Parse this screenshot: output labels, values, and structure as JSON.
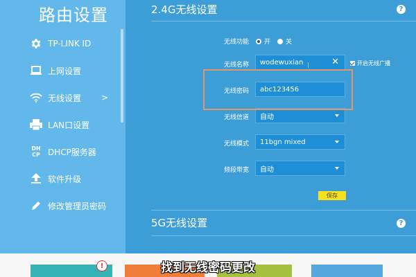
{
  "sidebar": {
    "title": "路由设置",
    "items": [
      {
        "label": "TP-LINK ID",
        "icon": "gear-icon"
      },
      {
        "label": "上网设置",
        "icon": "monitor-icon"
      },
      {
        "label": "无线设置",
        "icon": "wifi-icon",
        "chevron": ">"
      },
      {
        "label": "LAN口设置",
        "icon": "printer-icon"
      },
      {
        "label": "DHCP服务器",
        "icon": "dhcp-icon",
        "icon_text_top": "DH",
        "icon_text_bottom": "CP"
      },
      {
        "label": "软件升级",
        "icon": "upload-icon"
      },
      {
        "label": "修改管理员密码",
        "icon": "pencil-icon"
      }
    ]
  },
  "wifi24": {
    "title": "2.4G无线设置",
    "help": "?",
    "enable_label": "无线功能",
    "on_label": "开",
    "off_label": "关",
    "ssid_label": "无线名称",
    "ssid_value": "wodewuxian",
    "clear_glyph": "✕",
    "broadcast_label": "开启无线广播",
    "password_label": "无线密码",
    "password_value": "abc123456",
    "channel_label": "无线信道",
    "channel_value": "自动",
    "mode_label": "无线模式",
    "mode_value": "11bgn mixed",
    "bandwidth_label": "频段带宽",
    "bandwidth_value": "自动",
    "save_label": "保存"
  },
  "wifi5": {
    "title": "5G无线设置",
    "help": "?"
  },
  "bottom": {
    "alert": "!",
    "caption": "找到无线密码更改"
  },
  "colors": {
    "sidebar_bg": "#62b8ea",
    "main_bg": "#3d9ed7",
    "field_bg": "#1e8fd6",
    "highlight": "#e2966a",
    "save_button": "#f6e21b"
  }
}
